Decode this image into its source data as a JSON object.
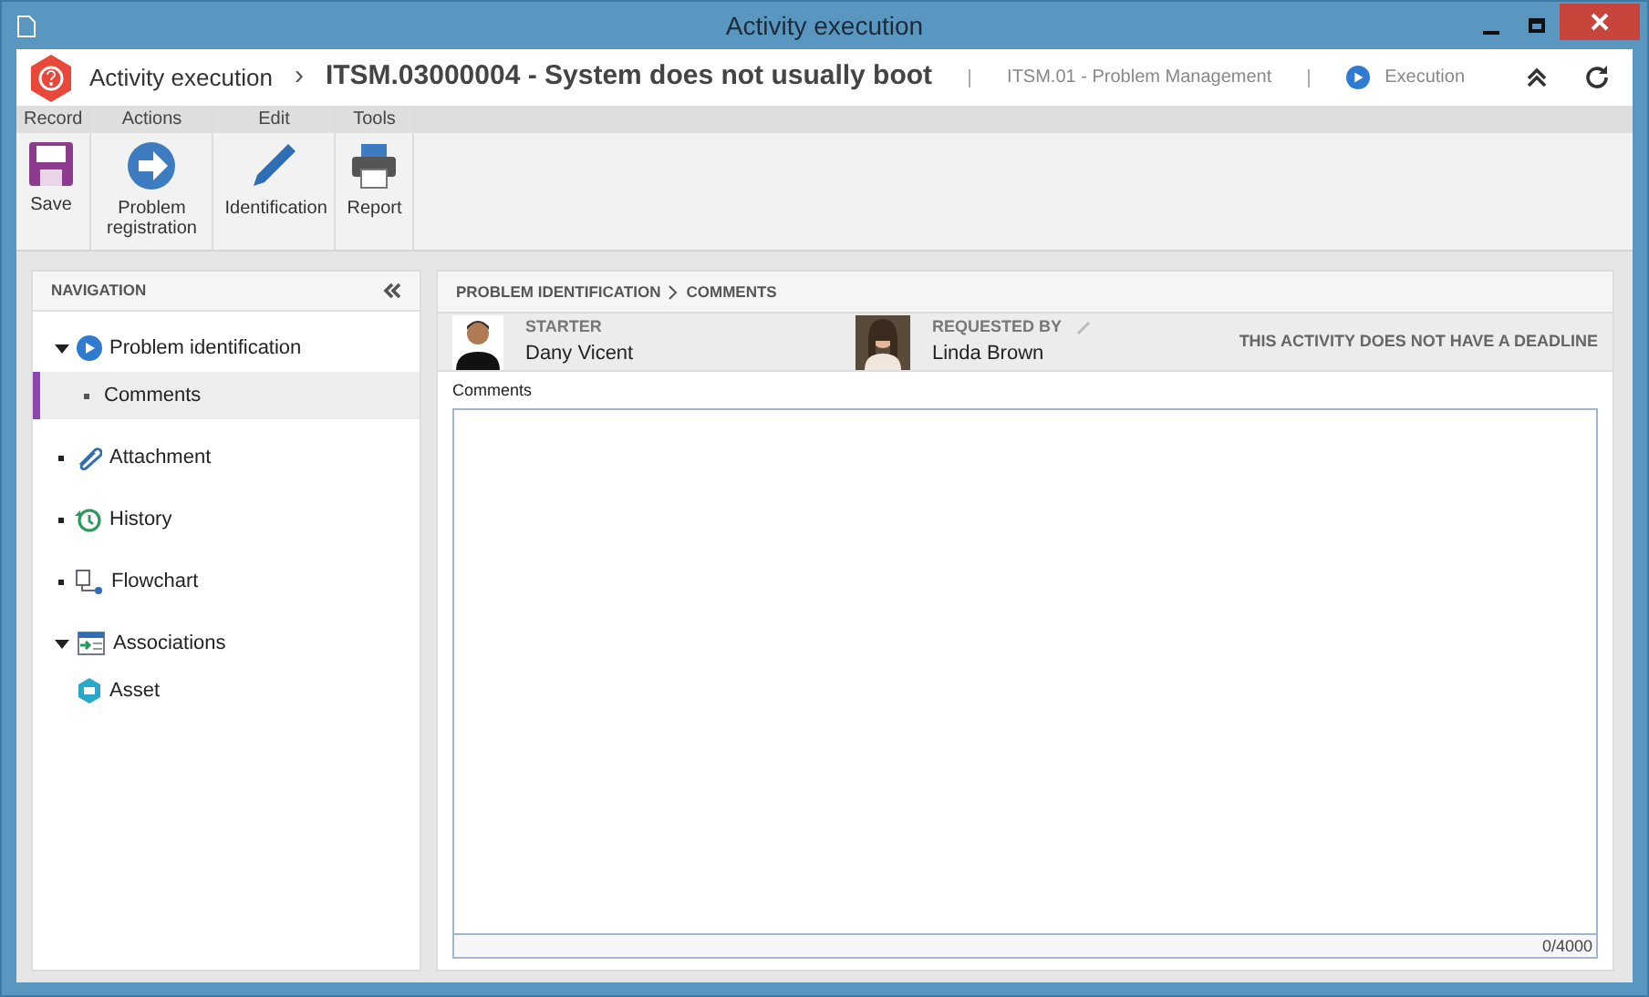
{
  "window": {
    "title": "Activity execution"
  },
  "header": {
    "module": "Activity execution",
    "separator": "›",
    "record": "ITSM.03000004 - System does not usually boot",
    "process": "ITSM.01 - Problem Management",
    "status": "Execution"
  },
  "ribbon": [
    {
      "group": "Record",
      "buttons": [
        {
          "kind": "save",
          "label": "Save"
        }
      ]
    },
    {
      "group": "Actions",
      "buttons": [
        {
          "kind": "forward",
          "label": "Problem registration"
        }
      ]
    },
    {
      "group": "Edit",
      "buttons": [
        {
          "kind": "pencil",
          "label": "Identification"
        }
      ]
    },
    {
      "group": "Tools",
      "buttons": [
        {
          "kind": "printer",
          "label": "Report"
        }
      ]
    }
  ],
  "navigation": {
    "title": "NAVIGATION",
    "items": [
      {
        "kind": "task",
        "label": "Problem identification",
        "expanded": true,
        "selected": false,
        "children": [
          {
            "kind": "leaf",
            "label": "Comments",
            "selected": true
          }
        ]
      },
      {
        "kind": "attachment",
        "label": "Attachment",
        "selected": false
      },
      {
        "kind": "history",
        "label": "History",
        "selected": false
      },
      {
        "kind": "flowchart",
        "label": "Flowchart",
        "selected": false
      },
      {
        "kind": "associations",
        "label": "Associations",
        "expanded": true,
        "selected": false,
        "children": [
          {
            "kind": "asset",
            "label": "Asset",
            "selected": false
          }
        ]
      }
    ]
  },
  "breadcrumb": [
    "PROBLEM IDENTIFICATION",
    "COMMENTS"
  ],
  "people": [
    {
      "role": "STARTER",
      "name": "Dany Vicent",
      "editable": false
    },
    {
      "role": "REQUESTED BY",
      "name": "Linda Brown",
      "editable": true
    }
  ],
  "deadline": "THIS ACTIVITY DOES NOT HAVE A DEADLINE",
  "comments": {
    "label": "Comments",
    "counter": "0/4000"
  }
}
